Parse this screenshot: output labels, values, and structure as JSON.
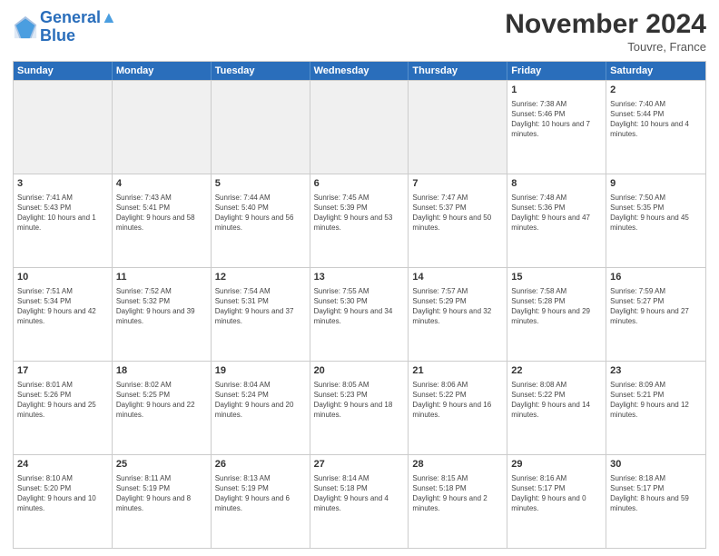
{
  "header": {
    "logo_line1": "General",
    "logo_line2": "Blue",
    "month": "November 2024",
    "location": "Touvre, France"
  },
  "weekdays": [
    "Sunday",
    "Monday",
    "Tuesday",
    "Wednesday",
    "Thursday",
    "Friday",
    "Saturday"
  ],
  "rows": [
    [
      {
        "day": "",
        "info": "",
        "shaded": true
      },
      {
        "day": "",
        "info": "",
        "shaded": true
      },
      {
        "day": "",
        "info": "",
        "shaded": true
      },
      {
        "day": "",
        "info": "",
        "shaded": true
      },
      {
        "day": "",
        "info": "",
        "shaded": true
      },
      {
        "day": "1",
        "info": "Sunrise: 7:38 AM\nSunset: 5:46 PM\nDaylight: 10 hours and 7 minutes.",
        "shaded": false
      },
      {
        "day": "2",
        "info": "Sunrise: 7:40 AM\nSunset: 5:44 PM\nDaylight: 10 hours and 4 minutes.",
        "shaded": false
      }
    ],
    [
      {
        "day": "3",
        "info": "Sunrise: 7:41 AM\nSunset: 5:43 PM\nDaylight: 10 hours and 1 minute.",
        "shaded": false
      },
      {
        "day": "4",
        "info": "Sunrise: 7:43 AM\nSunset: 5:41 PM\nDaylight: 9 hours and 58 minutes.",
        "shaded": false
      },
      {
        "day": "5",
        "info": "Sunrise: 7:44 AM\nSunset: 5:40 PM\nDaylight: 9 hours and 56 minutes.",
        "shaded": false
      },
      {
        "day": "6",
        "info": "Sunrise: 7:45 AM\nSunset: 5:39 PM\nDaylight: 9 hours and 53 minutes.",
        "shaded": false
      },
      {
        "day": "7",
        "info": "Sunrise: 7:47 AM\nSunset: 5:37 PM\nDaylight: 9 hours and 50 minutes.",
        "shaded": false
      },
      {
        "day": "8",
        "info": "Sunrise: 7:48 AM\nSunset: 5:36 PM\nDaylight: 9 hours and 47 minutes.",
        "shaded": false
      },
      {
        "day": "9",
        "info": "Sunrise: 7:50 AM\nSunset: 5:35 PM\nDaylight: 9 hours and 45 minutes.",
        "shaded": false
      }
    ],
    [
      {
        "day": "10",
        "info": "Sunrise: 7:51 AM\nSunset: 5:34 PM\nDaylight: 9 hours and 42 minutes.",
        "shaded": false
      },
      {
        "day": "11",
        "info": "Sunrise: 7:52 AM\nSunset: 5:32 PM\nDaylight: 9 hours and 39 minutes.",
        "shaded": false
      },
      {
        "day": "12",
        "info": "Sunrise: 7:54 AM\nSunset: 5:31 PM\nDaylight: 9 hours and 37 minutes.",
        "shaded": false
      },
      {
        "day": "13",
        "info": "Sunrise: 7:55 AM\nSunset: 5:30 PM\nDaylight: 9 hours and 34 minutes.",
        "shaded": false
      },
      {
        "day": "14",
        "info": "Sunrise: 7:57 AM\nSunset: 5:29 PM\nDaylight: 9 hours and 32 minutes.",
        "shaded": false
      },
      {
        "day": "15",
        "info": "Sunrise: 7:58 AM\nSunset: 5:28 PM\nDaylight: 9 hours and 29 minutes.",
        "shaded": false
      },
      {
        "day": "16",
        "info": "Sunrise: 7:59 AM\nSunset: 5:27 PM\nDaylight: 9 hours and 27 minutes.",
        "shaded": false
      }
    ],
    [
      {
        "day": "17",
        "info": "Sunrise: 8:01 AM\nSunset: 5:26 PM\nDaylight: 9 hours and 25 minutes.",
        "shaded": false
      },
      {
        "day": "18",
        "info": "Sunrise: 8:02 AM\nSunset: 5:25 PM\nDaylight: 9 hours and 22 minutes.",
        "shaded": false
      },
      {
        "day": "19",
        "info": "Sunrise: 8:04 AM\nSunset: 5:24 PM\nDaylight: 9 hours and 20 minutes.",
        "shaded": false
      },
      {
        "day": "20",
        "info": "Sunrise: 8:05 AM\nSunset: 5:23 PM\nDaylight: 9 hours and 18 minutes.",
        "shaded": false
      },
      {
        "day": "21",
        "info": "Sunrise: 8:06 AM\nSunset: 5:22 PM\nDaylight: 9 hours and 16 minutes.",
        "shaded": false
      },
      {
        "day": "22",
        "info": "Sunrise: 8:08 AM\nSunset: 5:22 PM\nDaylight: 9 hours and 14 minutes.",
        "shaded": false
      },
      {
        "day": "23",
        "info": "Sunrise: 8:09 AM\nSunset: 5:21 PM\nDaylight: 9 hours and 12 minutes.",
        "shaded": false
      }
    ],
    [
      {
        "day": "24",
        "info": "Sunrise: 8:10 AM\nSunset: 5:20 PM\nDaylight: 9 hours and 10 minutes.",
        "shaded": false
      },
      {
        "day": "25",
        "info": "Sunrise: 8:11 AM\nSunset: 5:19 PM\nDaylight: 9 hours and 8 minutes.",
        "shaded": false
      },
      {
        "day": "26",
        "info": "Sunrise: 8:13 AM\nSunset: 5:19 PM\nDaylight: 9 hours and 6 minutes.",
        "shaded": false
      },
      {
        "day": "27",
        "info": "Sunrise: 8:14 AM\nSunset: 5:18 PM\nDaylight: 9 hours and 4 minutes.",
        "shaded": false
      },
      {
        "day": "28",
        "info": "Sunrise: 8:15 AM\nSunset: 5:18 PM\nDaylight: 9 hours and 2 minutes.",
        "shaded": false
      },
      {
        "day": "29",
        "info": "Sunrise: 8:16 AM\nSunset: 5:17 PM\nDaylight: 9 hours and 0 minutes.",
        "shaded": false
      },
      {
        "day": "30",
        "info": "Sunrise: 8:18 AM\nSunset: 5:17 PM\nDaylight: 8 hours and 59 minutes.",
        "shaded": false
      }
    ]
  ]
}
